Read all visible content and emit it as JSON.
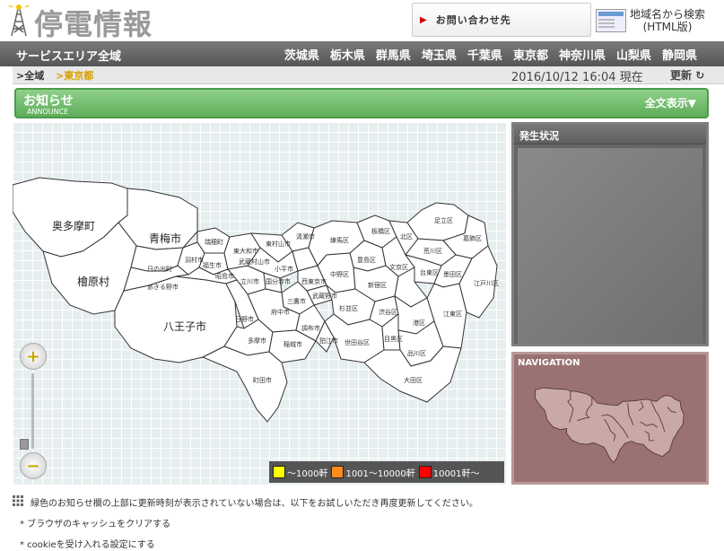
{
  "header": {
    "site_title": "停電情報",
    "contact_label": "お問い合わせ先",
    "region_search_line1": "地域名から検索",
    "region_search_line2": "(HTML版)"
  },
  "pref_nav": {
    "service_area": "サービスエリア全域",
    "prefectures": [
      "茨城県",
      "栃木県",
      "群馬県",
      "埼玉県",
      "千葉県",
      "東京都",
      "神奈川県",
      "山梨県",
      "静岡県"
    ]
  },
  "breadcrumb": {
    "all": ">全域",
    "current": ">東京都",
    "datetime": "2016/10/12 16:04 現在",
    "refresh": "更新"
  },
  "announce": {
    "title": "お知らせ",
    "subtitle": "ANNOUNCE",
    "full_text": "全文表示▼"
  },
  "map": {
    "municipalities_large": [
      "奥多摩町",
      "青梅市",
      "檜原村",
      "八王子市"
    ],
    "municipalities_small": [
      "日の出町",
      "あきる野市",
      "瑞穂町",
      "羽村市",
      "福生市",
      "昭島市",
      "立川市",
      "東村山市",
      "清瀬市",
      "小平市",
      "国分寺市",
      "東大和市",
      "武蔵村山市",
      "西東京市",
      "武蔵野市",
      "三鷹市",
      "府中市",
      "調布市",
      "狛江市",
      "日野市",
      "多摩市",
      "稲城市",
      "町田市",
      "練馬区",
      "板橋区",
      "北区",
      "足立区",
      "葛飾区",
      "荒川区",
      "台東区",
      "文京区",
      "豊島区",
      "中野区",
      "杉並区",
      "新宿区",
      "渋谷区",
      "世田谷区",
      "目黒区",
      "品川区",
      "大田区",
      "江戸川区",
      "江東区",
      "墨田区",
      "港区"
    ],
    "zoom_in_icon": "zoom-in-icon",
    "zoom_out_icon": "zoom-out-icon"
  },
  "legend": [
    {
      "label": "〜1000軒",
      "color": "#ffff00"
    },
    {
      "label": "1001〜10000軒",
      "color": "#ff8c1a"
    },
    {
      "label": "10001軒〜",
      "color": "#ff0000"
    }
  ],
  "status_panel": {
    "title": "発生状況"
  },
  "nav_panel": {
    "title": "NAVIGATION"
  },
  "notes": {
    "main": "緑色のお知らせ欄の上部に更新時刻が表示されていない場合は、以下をお試しいただき再度更新してください。",
    "item1": "* ブラウザのキャッシュをクリアする",
    "item2": "* cookieを受け入れる設定にする"
  },
  "colors": {
    "announce_green": "#6cbf66",
    "nav_bar_gray": "#666666",
    "crumb_accent": "#d4a000",
    "navigation_panel": "#9a7272"
  }
}
